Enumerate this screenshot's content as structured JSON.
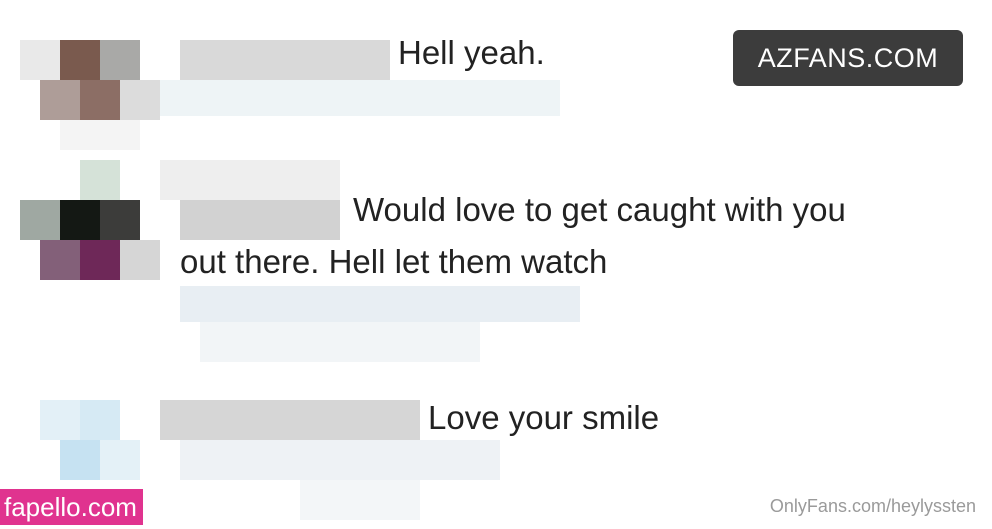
{
  "watermark": {
    "label": "AZFANS.COM"
  },
  "comments": [
    {
      "lines": [
        "Hell yeah."
      ]
    },
    {
      "lines": [
        "Would love to get caught with you",
        "out there. Hell let them watch"
      ]
    },
    {
      "lines": [
        "Love your smile"
      ]
    }
  ],
  "footer": {
    "fapello_label": "fapello.com",
    "onlyfans_url": "OnlyFans.com/heylyssten"
  },
  "colors": {
    "text": "#222222",
    "watermark_bg": "#3c3c3c",
    "fapello_bg": "#e0338f",
    "url_text": "#9a9a9a"
  }
}
